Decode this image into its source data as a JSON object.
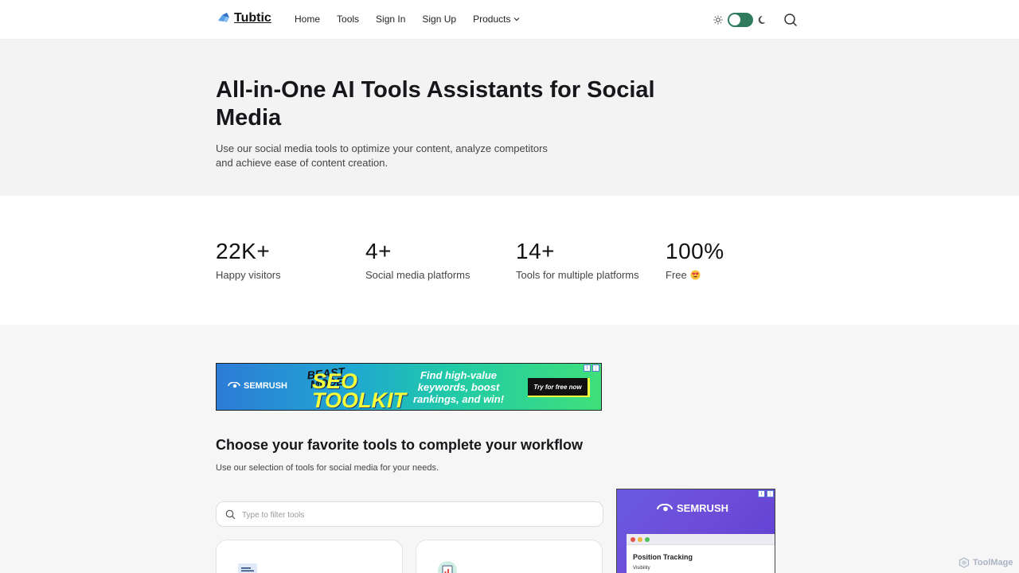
{
  "header": {
    "logo_text": "Tubtic",
    "nav": [
      {
        "label": "Home"
      },
      {
        "label": "Tools"
      },
      {
        "label": "Sign In"
      },
      {
        "label": "Sign Up"
      },
      {
        "label": "Products"
      }
    ]
  },
  "hero": {
    "title": "All-in-One AI Tools Assistants for Social Media",
    "subtitle": "Use our social media tools to optimize your content, analyze competitors and achieve ease of content creation."
  },
  "stats": [
    {
      "value": "22K+",
      "label": "Happy visitors"
    },
    {
      "value": "4+",
      "label": "Social media platforms"
    },
    {
      "value": "14+",
      "label": "Tools for multiple platforms"
    },
    {
      "value": "100%",
      "label": "Free"
    }
  ],
  "ad_banner": {
    "brand": "SEMRUSH",
    "beast_mode": "BEAST MODE",
    "seo_toolkit": "SEO TOOLKIT",
    "copy": "Find high-value keywords, boost rankings, and win!",
    "cta": "Try for free now"
  },
  "tools": {
    "title": "Choose your favorite tools to complete your workflow",
    "subtitle": "Use our selection of tools for social media for your needs.",
    "filter_placeholder": "Type to filter tools"
  },
  "side_ad": {
    "brand": "SEMRUSH",
    "window_title": "Position Tracking",
    "window_sub": "Visibility"
  },
  "watermark": "ToolMage",
  "colors": {
    "toggle_accent": "#2f7a5d",
    "ad_yellow": "#f7ff3a",
    "side_ad_purple": "#6a5ae0"
  }
}
